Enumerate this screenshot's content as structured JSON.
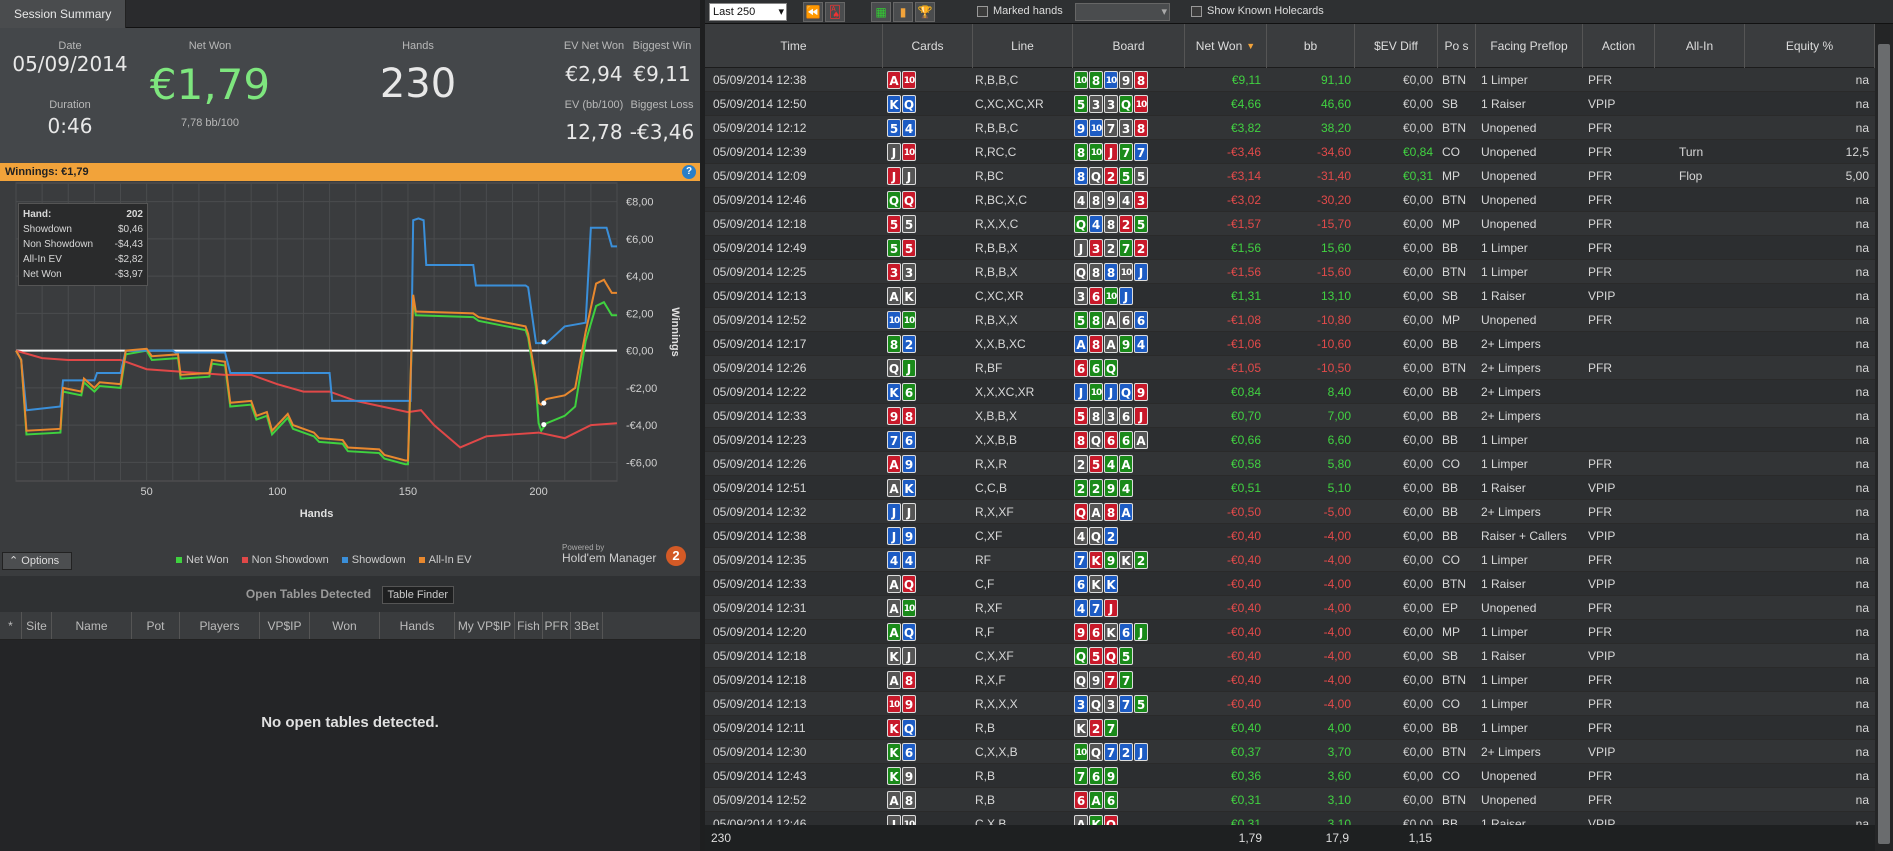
{
  "tab": "Session Summary",
  "summary": {
    "date_label": "Date",
    "date": "05/09/2014",
    "duration_label": "Duration",
    "duration": "0:46",
    "netwon_label": "Net Won",
    "netwon": "€1,79",
    "bb100": "7,78 bb/100",
    "hands_label": "Hands",
    "hands": "230",
    "ev_label": "EV Net Won",
    "ev": "€2,94",
    "bw_label": "Biggest Win",
    "bw": "€9,11",
    "evbb_label": "EV (bb/100)",
    "evbb": "12,78",
    "bl_label": "Biggest Loss",
    "bl": "-€3,46"
  },
  "winnings_bar": "Winnings:  €1,79",
  "help": "?",
  "tooltip": {
    "hand_label": "Hand:",
    "hand": "202",
    "rows": [
      {
        "k": "Showdown",
        "v": "$0,46"
      },
      {
        "k": "Non Showdown",
        "v": "-$4,43"
      },
      {
        "k": "All-In EV",
        "v": "-$2,82"
      },
      {
        "k": "Net Won",
        "v": "-$3,97"
      }
    ]
  },
  "chart_data": {
    "type": "line",
    "xlabel": "Hands",
    "ylabel": "Winnings",
    "xticks": [
      "50",
      "100",
      "150",
      "200"
    ],
    "yticks": [
      "€8,00",
      "€6,00",
      "€4,00",
      "€2,00",
      "€0,00",
      "-€2,00",
      "-€4,00",
      "-€6,00"
    ],
    "ylim": [
      -7,
      9
    ],
    "xlim": [
      0,
      230
    ],
    "series": [
      {
        "name": "Net Won",
        "color": "#3fd13f",
        "x": [
          0,
          2,
          4,
          17,
          18,
          25,
          26,
          30,
          32,
          40,
          42,
          50,
          52,
          62,
          63,
          74,
          75,
          80,
          82,
          90,
          92,
          96,
          98,
          104,
          106,
          114,
          116,
          125,
          127,
          139,
          141,
          149,
          150,
          152,
          153,
          175,
          177,
          195,
          196,
          199,
          200,
          201,
          203,
          210,
          214,
          218,
          222,
          225,
          228,
          230
        ],
        "y": [
          0,
          -0.5,
          -4.5,
          -4.4,
          -2.2,
          -2.4,
          -1.7,
          -2.2,
          -1.9,
          -2.0,
          -0.2,
          0,
          -0.5,
          -0.4,
          -1.5,
          -1.4,
          -0.7,
          -0.8,
          -3.0,
          -2.9,
          -3.7,
          -3.5,
          -4.5,
          -3.6,
          -4.2,
          -4.6,
          -4.9,
          -5.0,
          -5.4,
          -5.5,
          -5.8,
          -6.1,
          -6.1,
          2.8,
          1.9,
          1.8,
          1.6,
          1.1,
          0.7,
          -2.0,
          -3.9,
          -4.3,
          -3.9,
          -3.5,
          -3.0,
          0.5,
          2.4,
          2.6,
          1.9,
          1.9
        ]
      },
      {
        "name": "Non Showdown",
        "color": "#e04848",
        "x": [
          0,
          10,
          20,
          30,
          40,
          50,
          60,
          70,
          80,
          90,
          100,
          110,
          120,
          130,
          140,
          150,
          155,
          160,
          170,
          180,
          190,
          200,
          210,
          220,
          230
        ],
        "y": [
          0,
          -0.4,
          -0.5,
          -0.5,
          -0.5,
          -1.0,
          -1.1,
          -1.2,
          -1.3,
          -1.3,
          -1.8,
          -2.2,
          -2.2,
          -2.7,
          -3.0,
          -3.3,
          -3.2,
          -4.0,
          -5.2,
          -4.6,
          -4.5,
          -4.4,
          -4.7,
          -4.0,
          -3.9
        ]
      },
      {
        "name": "Showdown",
        "color": "#3a8fd9",
        "x": [
          0,
          2,
          4,
          17,
          18,
          30,
          31,
          40,
          42,
          60,
          61,
          80,
          82,
          120,
          121,
          150,
          151,
          152,
          154,
          156,
          157,
          175,
          176,
          195,
          196,
          199,
          200,
          201,
          203,
          210,
          214,
          218,
          220,
          223,
          226,
          228,
          230
        ],
        "y": [
          0,
          -0.5,
          -3.2,
          -3.0,
          -1.6,
          -1.6,
          -1.2,
          -1.2,
          0,
          0,
          -0.1,
          -0.1,
          -1.2,
          -1.2,
          -2.7,
          -2.7,
          -2.7,
          7.0,
          7.1,
          7.0,
          4.6,
          4.6,
          3.5,
          3.5,
          3.4,
          0.4,
          0.4,
          0.4,
          0.4,
          1.3,
          1.4,
          1.5,
          6.6,
          6.6,
          6.6,
          5.6,
          5.6
        ]
      },
      {
        "name": "All-In EV",
        "color": "#e8882e",
        "x": [
          0,
          2,
          4,
          17,
          18,
          25,
          26,
          30,
          32,
          40,
          42,
          50,
          52,
          62,
          63,
          74,
          75,
          80,
          82,
          90,
          92,
          96,
          98,
          104,
          106,
          114,
          116,
          125,
          127,
          139,
          141,
          149,
          150,
          152,
          153,
          175,
          177,
          195,
          196,
          199,
          200,
          201,
          203,
          210,
          214,
          218,
          222,
          225,
          228,
          230
        ],
        "y": [
          0,
          -0.5,
          -4.3,
          -4.2,
          -2.0,
          -2.2,
          -1.5,
          -2.0,
          -1.7,
          -1.8,
          0,
          0.1,
          -0.3,
          -0.2,
          -1.3,
          -1.2,
          -0.5,
          -0.6,
          -2.8,
          -2.7,
          -3.5,
          -3.3,
          -4.3,
          -3.4,
          -4.0,
          -4.4,
          -4.7,
          -4.8,
          -5.2,
          -5.3,
          -5.6,
          -5.9,
          -5.9,
          3.0,
          2.1,
          2.0,
          1.8,
          1.3,
          0.9,
          -1.6,
          -2.8,
          -2.9,
          -2.6,
          -2.4,
          -2.0,
          1.0,
          3.6,
          3.8,
          3.1,
          3.1
        ]
      }
    ]
  },
  "legend": [
    {
      "name": "Net Won",
      "color": "#3fd13f"
    },
    {
      "name": "Non Showdown",
      "color": "#e04848"
    },
    {
      "name": "Showdown",
      "color": "#3a8fd9"
    },
    {
      "name": "All-In EV",
      "color": "#e8882e"
    }
  ],
  "options": "⌃ Options",
  "powered_by": "Powered by",
  "hm": "Hold'em Manager",
  "hm_badge": "2",
  "open_tables": {
    "title": "Open Tables Detected",
    "finder": "Table Finder",
    "cols": [
      "*",
      "Site",
      "Name",
      "Pot",
      "Players",
      "VP$IP",
      "Won",
      "Hands",
      "My VP$IP",
      "Fish",
      "PFR",
      "3Bet"
    ],
    "empty": "No open tables detected."
  },
  "toolbar": {
    "filter": "Last 250",
    "marked": "Marked hands",
    "known": "Show Known Holecards"
  },
  "columns": [
    "Time",
    "Cards",
    "Line",
    "Board",
    "Net Won",
    "bb",
    "$EV Diff",
    "Po s",
    "Facing Preflop",
    "Action",
    "All-In",
    "Equity %"
  ],
  "rows": [
    {
      "t": "05/09/2014 12:38",
      "cards": [
        "A-h",
        "10-h"
      ],
      "line": "R,B,B,C",
      "board": [
        "10-c",
        "8-c",
        "10-d",
        "9-s",
        "8-h"
      ],
      "nw": "€9,11",
      "bb": "91,10",
      "ev": "€0,00",
      "pos": "BTN",
      "face": "1 Limper",
      "act": "PFR",
      "ai": "",
      "eq": "na"
    },
    {
      "t": "05/09/2014 12:50",
      "cards": [
        "K-d",
        "Q-d"
      ],
      "line": "C,XC,XC,XR",
      "board": [
        "5-c",
        "3-s",
        "3-s",
        "Q-c",
        "10-h"
      ],
      "nw": "€4,66",
      "bb": "46,60",
      "ev": "€0,00",
      "pos": "SB",
      "face": "1 Raiser",
      "act": "VPIP",
      "ai": "",
      "eq": "na"
    },
    {
      "t": "05/09/2014 12:12",
      "cards": [
        "5-d",
        "4-d"
      ],
      "line": "R,B,B,C",
      "board": [
        "9-d",
        "10-d",
        "7-s",
        "3-s",
        "8-h"
      ],
      "nw": "€3,82",
      "bb": "38,20",
      "ev": "€0,00",
      "pos": "BTN",
      "face": "Unopened",
      "act": "PFR",
      "ai": "",
      "eq": "na"
    },
    {
      "t": "05/09/2014 12:39",
      "cards": [
        "J-s",
        "10-h"
      ],
      "line": "R,RC,C",
      "board": [
        "8-c",
        "10-c",
        "J-h",
        "7-c",
        "7-d"
      ],
      "nw": "-€3,46",
      "bb": "-34,60",
      "ev": "€0,84",
      "pos": "CO",
      "face": "Unopened",
      "act": "PFR",
      "ai": "Turn",
      "eq": "12,5"
    },
    {
      "t": "05/09/2014 12:09",
      "cards": [
        "J-h",
        "J-s"
      ],
      "line": "R,BC",
      "board": [
        "8-d",
        "Q-s",
        "2-h",
        "5-c",
        "5-s"
      ],
      "nw": "-€3,14",
      "bb": "-31,40",
      "ev": "€0,31",
      "pos": "MP",
      "face": "Unopened",
      "act": "PFR",
      "ai": "Flop",
      "eq": "5,00"
    },
    {
      "t": "05/09/2014 12:46",
      "cards": [
        "Q-c",
        "Q-h"
      ],
      "line": "R,BC,X,C",
      "board": [
        "4-s",
        "8-s",
        "9-s",
        "4-s",
        "3-h"
      ],
      "nw": "-€3,02",
      "bb": "-30,20",
      "ev": "€0,00",
      "pos": "BTN",
      "face": "Unopened",
      "act": "PFR",
      "ai": "",
      "eq": "na"
    },
    {
      "t": "05/09/2014 12:18",
      "cards": [
        "5-h",
        "5-s"
      ],
      "line": "R,X,X,C",
      "board": [
        "Q-c",
        "4-d",
        "8-s",
        "2-h",
        "5-c"
      ],
      "nw": "-€1,57",
      "bb": "-15,70",
      "ev": "€0,00",
      "pos": "MP",
      "face": "Unopened",
      "act": "PFR",
      "ai": "",
      "eq": "na"
    },
    {
      "t": "05/09/2014 12:49",
      "cards": [
        "5-c",
        "5-h"
      ],
      "line": "R,B,B,X",
      "board": [
        "J-s",
        "3-h",
        "2-s",
        "7-c",
        "2-h"
      ],
      "nw": "€1,56",
      "bb": "15,60",
      "ev": "€0,00",
      "pos": "BB",
      "face": "1 Limper",
      "act": "PFR",
      "ai": "",
      "eq": "na"
    },
    {
      "t": "05/09/2014 12:25",
      "cards": [
        "3-h",
        "3-s"
      ],
      "line": "R,B,B,X",
      "board": [
        "Q-s",
        "8-s",
        "8-d",
        "10-s",
        "J-d"
      ],
      "nw": "-€1,56",
      "bb": "-15,60",
      "ev": "€0,00",
      "pos": "BTN",
      "face": "1 Limper",
      "act": "PFR",
      "ai": "",
      "eq": "na"
    },
    {
      "t": "05/09/2014 12:13",
      "cards": [
        "A-s",
        "K-s"
      ],
      "line": "C,XC,XR",
      "board": [
        "3-s",
        "6-h",
        "10-c",
        "J-d"
      ],
      "nw": "€1,31",
      "bb": "13,10",
      "ev": "€0,00",
      "pos": "SB",
      "face": "1 Raiser",
      "act": "VPIP",
      "ai": "",
      "eq": "na"
    },
    {
      "t": "05/09/2014 12:52",
      "cards": [
        "10-d",
        "10-c"
      ],
      "line": "R,B,X,X",
      "board": [
        "5-c",
        "8-c",
        "A-s",
        "6-s",
        "6-d"
      ],
      "nw": "-€1,08",
      "bb": "-10,80",
      "ev": "€0,00",
      "pos": "MP",
      "face": "Unopened",
      "act": "PFR",
      "ai": "",
      "eq": "na"
    },
    {
      "t": "05/09/2014 12:17",
      "cards": [
        "8-c",
        "2-d"
      ],
      "line": "X,X,B,XC",
      "board": [
        "A-d",
        "8-h",
        "A-s",
        "9-c",
        "4-d"
      ],
      "nw": "-€1,06",
      "bb": "-10,60",
      "ev": "€0,00",
      "pos": "BB",
      "face": "2+ Limpers",
      "act": "",
      "ai": "",
      "eq": "na"
    },
    {
      "t": "05/09/2014 12:26",
      "cards": [
        "Q-s",
        "J-c"
      ],
      "line": "R,BF",
      "board": [
        "6-h",
        "6-c",
        "Q-c"
      ],
      "nw": "-€1,05",
      "bb": "-10,50",
      "ev": "€0,00",
      "pos": "BTN",
      "face": "2+ Limpers",
      "act": "PFR",
      "ai": "",
      "eq": "na"
    },
    {
      "t": "05/09/2014 12:22",
      "cards": [
        "K-d",
        "6-c"
      ],
      "line": "X,X,XC,XR",
      "board": [
        "J-d",
        "10-c",
        "J-d",
        "Q-d",
        "9-h"
      ],
      "nw": "€0,84",
      "bb": "8,40",
      "ev": "€0,00",
      "pos": "BB",
      "face": "2+ Limpers",
      "act": "",
      "ai": "",
      "eq": "na"
    },
    {
      "t": "05/09/2014 12:33",
      "cards": [
        "9-h",
        "8-h"
      ],
      "line": "X,B,B,X",
      "board": [
        "5-h",
        "8-s",
        "3-s",
        "6-s",
        "J-h"
      ],
      "nw": "€0,70",
      "bb": "7,00",
      "ev": "€0,00",
      "pos": "BB",
      "face": "2+ Limpers",
      "act": "",
      "ai": "",
      "eq": "na"
    },
    {
      "t": "05/09/2014 12:23",
      "cards": [
        "7-d",
        "6-d"
      ],
      "line": "X,X,B,B",
      "board": [
        "8-h",
        "Q-s",
        "6-h",
        "6-c",
        "A-s"
      ],
      "nw": "€0,66",
      "bb": "6,60",
      "ev": "€0,00",
      "pos": "BB",
      "face": "1 Limper",
      "act": "",
      "ai": "",
      "eq": "na"
    },
    {
      "t": "05/09/2014 12:26",
      "cards": [
        "A-h",
        "9-d"
      ],
      "line": "R,X,R",
      "board": [
        "2-s",
        "5-h",
        "4-c",
        "A-c"
      ],
      "nw": "€0,58",
      "bb": "5,80",
      "ev": "€0,00",
      "pos": "CO",
      "face": "1 Limper",
      "act": "PFR",
      "ai": "",
      "eq": "na"
    },
    {
      "t": "05/09/2014 12:51",
      "cards": [
        "A-s",
        "K-d"
      ],
      "line": "C,C,B",
      "board": [
        "2-c",
        "2-c",
        "9-c",
        "4-c"
      ],
      "nw": "€0,51",
      "bb": "5,10",
      "ev": "€0,00",
      "pos": "BB",
      "face": "1 Raiser",
      "act": "VPIP",
      "ai": "",
      "eq": "na"
    },
    {
      "t": "05/09/2014 12:32",
      "cards": [
        "J-d",
        "J-s"
      ],
      "line": "R,X,XF",
      "board": [
        "Q-h",
        "A-s",
        "8-h",
        "A-d"
      ],
      "nw": "-€0,50",
      "bb": "-5,00",
      "ev": "€0,00",
      "pos": "BB",
      "face": "2+ Limpers",
      "act": "PFR",
      "ai": "",
      "eq": "na"
    },
    {
      "t": "05/09/2014 12:38",
      "cards": [
        "J-d",
        "9-d"
      ],
      "line": "C,XF",
      "board": [
        "4-s",
        "Q-s",
        "2-d"
      ],
      "nw": "-€0,40",
      "bb": "-4,00",
      "ev": "€0,00",
      "pos": "BB",
      "face": "Raiser + Callers",
      "act": "VPIP",
      "ai": "",
      "eq": "na"
    },
    {
      "t": "05/09/2014 12:35",
      "cards": [
        "4-d",
        "4-d"
      ],
      "line": "RF",
      "board": [
        "7-d",
        "K-h",
        "9-c",
        "K-s",
        "2-c"
      ],
      "nw": "-€0,40",
      "bb": "-4,00",
      "ev": "€0,00",
      "pos": "CO",
      "face": "1 Limper",
      "act": "PFR",
      "ai": "",
      "eq": "na"
    },
    {
      "t": "05/09/2014 12:33",
      "cards": [
        "A-s",
        "Q-h"
      ],
      "line": "C,F",
      "board": [
        "6-d",
        "K-s",
        "K-d"
      ],
      "nw": "-€0,40",
      "bb": "-4,00",
      "ev": "€0,00",
      "pos": "BTN",
      "face": "1 Raiser",
      "act": "VPIP",
      "ai": "",
      "eq": "na"
    },
    {
      "t": "05/09/2014 12:31",
      "cards": [
        "A-s",
        "10-c"
      ],
      "line": "R,XF",
      "board": [
        "4-d",
        "7-d",
        "J-h"
      ],
      "nw": "-€0,40",
      "bb": "-4,00",
      "ev": "€0,00",
      "pos": "EP",
      "face": "Unopened",
      "act": "PFR",
      "ai": "",
      "eq": "na"
    },
    {
      "t": "05/09/2014 12:20",
      "cards": [
        "A-c",
        "Q-d"
      ],
      "line": "R,F",
      "board": [
        "9-h",
        "6-h",
        "K-s",
        "6-d",
        "J-c"
      ],
      "nw": "-€0,40",
      "bb": "-4,00",
      "ev": "€0,00",
      "pos": "MP",
      "face": "1 Limper",
      "act": "PFR",
      "ai": "",
      "eq": "na"
    },
    {
      "t": "05/09/2014 12:18",
      "cards": [
        "K-s",
        "J-s"
      ],
      "line": "C,X,XF",
      "board": [
        "Q-c",
        "5-h",
        "Q-h",
        "5-c"
      ],
      "nw": "-€0,40",
      "bb": "-4,00",
      "ev": "€0,00",
      "pos": "SB",
      "face": "1 Raiser",
      "act": "VPIP",
      "ai": "",
      "eq": "na"
    },
    {
      "t": "05/09/2014 12:18",
      "cards": [
        "A-s",
        "8-h"
      ],
      "line": "R,X,F",
      "board": [
        "Q-s",
        "9-s",
        "7-h",
        "7-c"
      ],
      "nw": "-€0,40",
      "bb": "-4,00",
      "ev": "€0,00",
      "pos": "BTN",
      "face": "1 Limper",
      "act": "PFR",
      "ai": "",
      "eq": "na"
    },
    {
      "t": "05/09/2014 12:13",
      "cards": [
        "10-h",
        "9-h"
      ],
      "line": "R,X,X,X",
      "board": [
        "3-d",
        "Q-s",
        "3-s",
        "7-d",
        "5-c"
      ],
      "nw": "-€0,40",
      "bb": "-4,00",
      "ev": "€0,00",
      "pos": "CO",
      "face": "1 Limper",
      "act": "PFR",
      "ai": "",
      "eq": "na"
    },
    {
      "t": "05/09/2014 12:11",
      "cards": [
        "K-h",
        "Q-d"
      ],
      "line": "R,B",
      "board": [
        "K-s",
        "2-h",
        "7-c"
      ],
      "nw": "€0,40",
      "bb": "4,00",
      "ev": "€0,00",
      "pos": "BB",
      "face": "1 Limper",
      "act": "PFR",
      "ai": "",
      "eq": "na"
    },
    {
      "t": "05/09/2014 12:30",
      "cards": [
        "K-c",
        "6-d"
      ],
      "line": "C,X,X,B",
      "board": [
        "10-c",
        "Q-s",
        "7-d",
        "2-d",
        "J-d"
      ],
      "nw": "€0,37",
      "bb": "3,70",
      "ev": "€0,00",
      "pos": "BTN",
      "face": "2+ Limpers",
      "act": "VPIP",
      "ai": "",
      "eq": "na"
    },
    {
      "t": "05/09/2014 12:43",
      "cards": [
        "K-c",
        "9-s"
      ],
      "line": "R,B",
      "board": [
        "7-c",
        "6-c",
        "9-c"
      ],
      "nw": "€0,36",
      "bb": "3,60",
      "ev": "€0,00",
      "pos": "CO",
      "face": "Unopened",
      "act": "PFR",
      "ai": "",
      "eq": "na"
    },
    {
      "t": "05/09/2014 12:52",
      "cards": [
        "A-s",
        "8-s"
      ],
      "line": "R,B",
      "board": [
        "6-h",
        "A-c",
        "6-c"
      ],
      "nw": "€0,31",
      "bb": "3,10",
      "ev": "€0,00",
      "pos": "BTN",
      "face": "Unopened",
      "act": "PFR",
      "ai": "",
      "eq": "na"
    },
    {
      "t": "05/09/2014 12:46",
      "cards": [
        "J-s",
        "10-s"
      ],
      "line": "C,X,B",
      "board": [
        "A-s",
        "K-c",
        "Q-h"
      ],
      "nw": "€0,31",
      "bb": "3,10",
      "ev": "€0,00",
      "pos": "BB",
      "face": "1 Raiser",
      "act": "VPIP",
      "ai": "",
      "eq": "na"
    }
  ],
  "footer": {
    "count": "230",
    "nw": "1,79",
    "bb": "17,9",
    "ev": "1,15"
  }
}
